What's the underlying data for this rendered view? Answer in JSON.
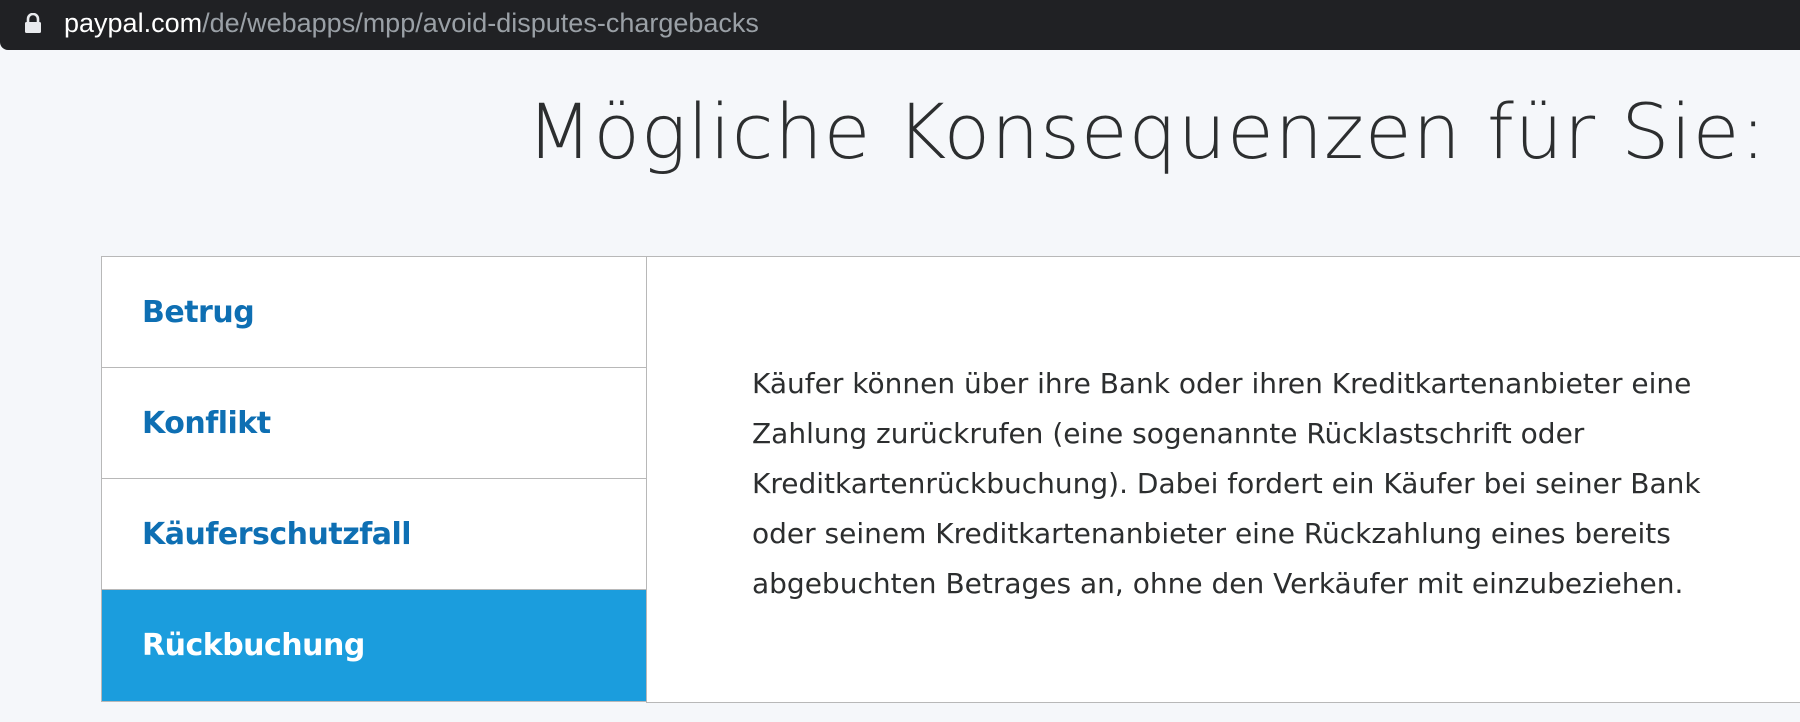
{
  "browser": {
    "url_domain": "paypal.com",
    "url_path": "/de/webapps/mpp/avoid-disputes-chargebacks"
  },
  "page": {
    "title": "Mögliche Konsequenzen für Sie:"
  },
  "tabs": [
    {
      "label": "Betrug",
      "active": false
    },
    {
      "label": "Konflikt",
      "active": false
    },
    {
      "label": "Käuferschutzfall",
      "active": false
    },
    {
      "label": "Rückbuchung",
      "active": true
    }
  ],
  "panel": {
    "text": "Käufer können über ihre Bank oder ihren Kreditkartenanbieter eine Zahlung zurückrufen (eine sogenannte Rücklastschrift oder Kreditkartenrückbuchung). Dabei fordert ein Käufer bei seiner Bank oder seinem Kreditkartenanbieter eine Rückzahlung eines bereits abgebuchten Betrages an, ohne den Verkäufer mit einzubeziehen."
  },
  "colors": {
    "accent": "#1b9ddd",
    "link": "#0e6fb3",
    "text": "#2c2e2f",
    "background": "#f5f7fa"
  },
  "icons": {
    "lock": "lock-icon"
  }
}
